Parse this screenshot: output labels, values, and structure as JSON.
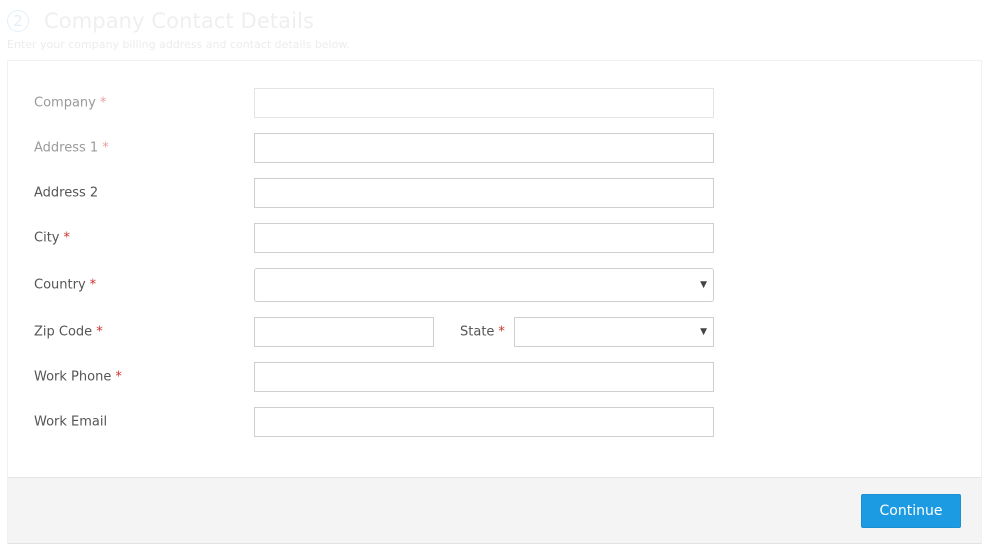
{
  "step": {
    "number": "2",
    "title": "Company Contact Details",
    "subtitle": "Enter your company billing address and contact details below."
  },
  "form": {
    "required_marker": "*",
    "fields": {
      "company": {
        "label": "Company",
        "value": ""
      },
      "address1": {
        "label": "Address 1",
        "value": ""
      },
      "address2": {
        "label": "Address 2",
        "value": ""
      },
      "city": {
        "label": "City",
        "value": ""
      },
      "country": {
        "label": "Country",
        "selected": ""
      },
      "zip": {
        "label": "Zip Code",
        "value": ""
      },
      "state": {
        "label": "State",
        "selected": ""
      },
      "work_phone": {
        "label": "Work Phone",
        "value": ""
      },
      "work_email": {
        "label": "Work Email",
        "value": ""
      }
    },
    "select_caret": "▼"
  },
  "footer": {
    "continue_label": "Continue"
  },
  "colors": {
    "accent": "#1d9be2",
    "required": "#c9302c",
    "footer_bg": "#f4f4f4"
  }
}
